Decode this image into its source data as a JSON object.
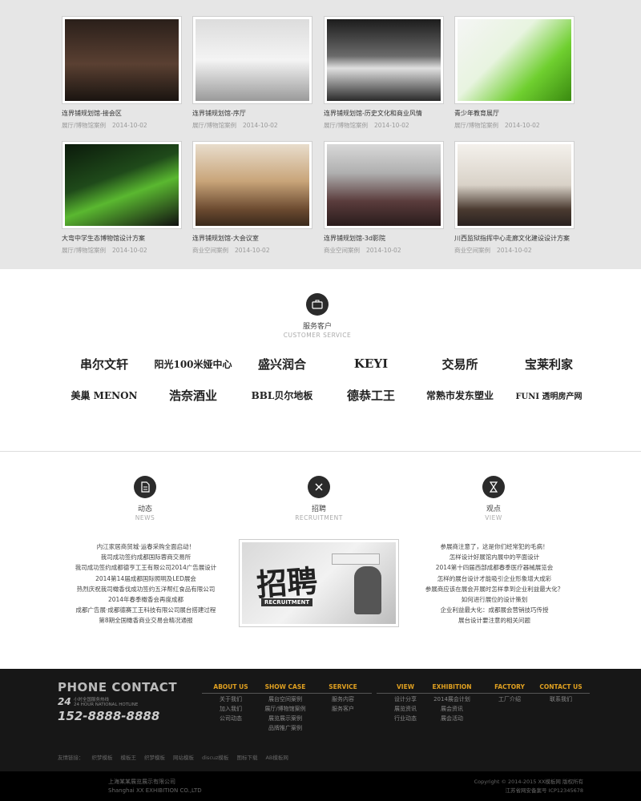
{
  "gallery": {
    "cards": [
      {
        "title": "连界铺规划馆-接会区",
        "category": "展厅/博物馆案例",
        "date": "2014-10-02",
        "art": "dark-lounge"
      },
      {
        "title": "连界铺规划馆-序厅",
        "category": "展厅/博物馆案例",
        "date": "2014-10-02",
        "art": "white-hall"
      },
      {
        "title": "连界铺规划馆-历史文化和商业风情",
        "category": "展厅/博物馆案例",
        "date": "2014-10-02",
        "art": "curved-wall"
      },
      {
        "title": "青少年教育展厅",
        "category": "展厅/博物馆案例",
        "date": "2014-10-02",
        "art": "green-room"
      },
      {
        "title": "大弯中学生态博物馆设计方案",
        "category": "展厅/博物馆案例",
        "date": "2014-10-02",
        "art": "green-dark"
      },
      {
        "title": "连界铺规划馆-大会议室",
        "category": "商业空间案例",
        "date": "2014-10-02",
        "art": "conference"
      },
      {
        "title": "连界铺规划馆-3d影院",
        "category": "商业空间案例",
        "date": "2014-10-02",
        "art": "cinema"
      },
      {
        "title": "川西监狱指挥中心走廊文化建设设计方案",
        "category": "商业空间案例",
        "date": "2014-10-02",
        "art": "office"
      }
    ]
  },
  "clients": {
    "title": "服务客户",
    "subtitle": "CUSTOMER SERVICE",
    "logos": [
      {
        "text": "串尔文轩"
      },
      {
        "text": "阳光100米娅中心"
      },
      {
        "text": "盛兴润合"
      },
      {
        "text": "KEYI"
      },
      {
        "text": "交易所"
      },
      {
        "text": "宝莱利家"
      },
      {
        "text": "美巢 MENON"
      },
      {
        "text": "浩奈酒业"
      },
      {
        "text": "BBL贝尔地板"
      },
      {
        "text": "德恭工王"
      },
      {
        "text": "常熟市发东塑业"
      },
      {
        "text": "FUNI 透明房产网"
      }
    ]
  },
  "news": {
    "title": "动态",
    "subtitle": "NEWS",
    "items": [
      "内江家居商贸城·运春采购全面启动！",
      "我司成功签约成都国际蓉商交易所",
      "我司成功签约成都德亨工王有限公司2014广告展设计",
      "2014第14届成都国际照明及LED展会",
      "热烈庆祝我司橄香伐成功签约五洋帮红食品有限公司",
      "2014年春季橄香会再度成都",
      "成都广告展·成都德赛工王科技有限公司展台搭建过程",
      "第8期全国橄香商业交易会精况通报"
    ]
  },
  "recruit": {
    "title": "招聘",
    "subtitle": "RECRUITMENT",
    "image_text": "招聘",
    "image_sub": "RECRUITMENT"
  },
  "view": {
    "title": "观点",
    "subtitle": "VIEW",
    "items": [
      "参展商注意了，这是你们经常犯的毛病！",
      "怎样设计好展馆内展中的平面设计",
      "2014第十四届西部成都春季医疗器械展览会",
      "怎样的展台设计才能吸引企业形象增大成彩",
      "参展商应该在展会开展时怎样拿到企业利益最大化？",
      "如何进行展位的设计策划",
      "企业利益最大化：成都展会营销技巧传授",
      "展台设计要注意的相关问题"
    ]
  },
  "footer": {
    "phone_title": "PHONE CONTACT",
    "phone_24": "24",
    "phone_small1": "小时全国服务热线",
    "phone_small2": "24 HOUR NATIONAL HOTLINE",
    "phone_number": "152-8888-8888",
    "columns": [
      {
        "head": "ABOUT US",
        "items": [
          "关于我们",
          "加入我们",
          "公司动态"
        ]
      },
      {
        "head": "SHOW CASE",
        "items": [
          "展台空间案例",
          "展厅/博物馆案例",
          "展览展示案例",
          "品牌推广案例"
        ]
      },
      {
        "head": "SERVICE",
        "items": [
          "服务内容",
          "服务客户"
        ]
      },
      {
        "head": "VIEW",
        "items": [
          "设计分享",
          "展览资讯",
          "行业动态"
        ]
      },
      {
        "head": "EXHIBITION",
        "items": [
          "2014展会计划",
          "展会资讯",
          "展会活动"
        ]
      },
      {
        "head": "FACTORY",
        "items": [
          "工厂介绍"
        ]
      },
      {
        "head": "CONTACT US",
        "items": [
          "联系我们"
        ]
      }
    ],
    "links": [
      "友情链接：",
      "织梦模板",
      "模板王",
      "织梦模板",
      "网站模板",
      "discuz模板",
      "图标下载",
      "AB模板网"
    ]
  },
  "bottom": {
    "company_cn": "上海某某展览展示有限公司",
    "company_en": "Shanghai XX EXHIBITION CO.,LTD",
    "copyright": "Copyright © 2014-2015 XX模板网 版权所有",
    "icp": "江苏省网安备案号 ICP12345678"
  },
  "colors": {
    "gallery_bg": "#e6e6e6",
    "footer_bg": "#171717",
    "footer_accent": "#e0a020"
  }
}
